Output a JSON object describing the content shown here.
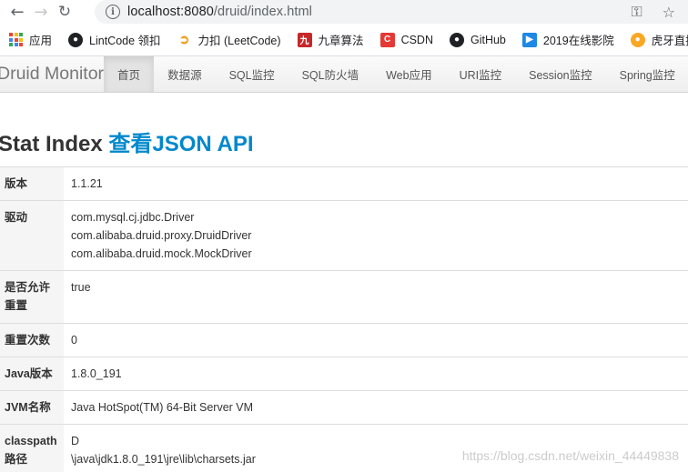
{
  "browser": {
    "url_host": "localhost:8080",
    "url_path": "/druid/index.html",
    "bookmarks": [
      {
        "label": "应用",
        "icon": "apps-icon"
      },
      {
        "label": "LintCode 领扣",
        "icon": "lintcode-icon"
      },
      {
        "label": "力扣 (LeetCode)",
        "icon": "leetcode-icon"
      },
      {
        "label": "九章算法",
        "icon": "jiuzhang-icon"
      },
      {
        "label": "CSDN",
        "icon": "csdn-icon"
      },
      {
        "label": "GitHub",
        "icon": "github-icon"
      },
      {
        "label": "2019在线影院",
        "icon": "video-icon"
      },
      {
        "label": "虎牙直播",
        "icon": "huya-icon"
      }
    ]
  },
  "navbar": {
    "brand": "Druid Monitor",
    "items": [
      "首页",
      "数据源",
      "SQL监控",
      "SQL防火墙",
      "Web应用",
      "URI监控",
      "Session监控",
      "Spring监控"
    ]
  },
  "page": {
    "title": "Stat Index",
    "api_link": "查看JSON API"
  },
  "stats": [
    {
      "label": "版本",
      "values": [
        "1.1.21"
      ]
    },
    {
      "label": "驱动",
      "values": [
        "com.mysql.cj.jdbc.Driver",
        "com.alibaba.druid.proxy.DruidDriver",
        "com.alibaba.druid.mock.MockDriver"
      ]
    },
    {
      "label": "是否允许重置",
      "values": [
        "true"
      ]
    },
    {
      "label": "重置次数",
      "values": [
        "0"
      ]
    },
    {
      "label": "Java版本",
      "values": [
        "1.8.0_191"
      ]
    },
    {
      "label": "JVM名称",
      "values": [
        "Java HotSpot(TM) 64-Bit Server VM"
      ]
    },
    {
      "label": "classpath路径",
      "values": [
        "D",
        "\\java\\jdk1.8.0_191\\jre\\lib\\charsets.jar"
      ]
    }
  ],
  "watermark": "https://blog.csdn.net/weixin_44449838",
  "colors": {
    "link": "#0088cc",
    "label_bg": "#f5f5f5"
  }
}
